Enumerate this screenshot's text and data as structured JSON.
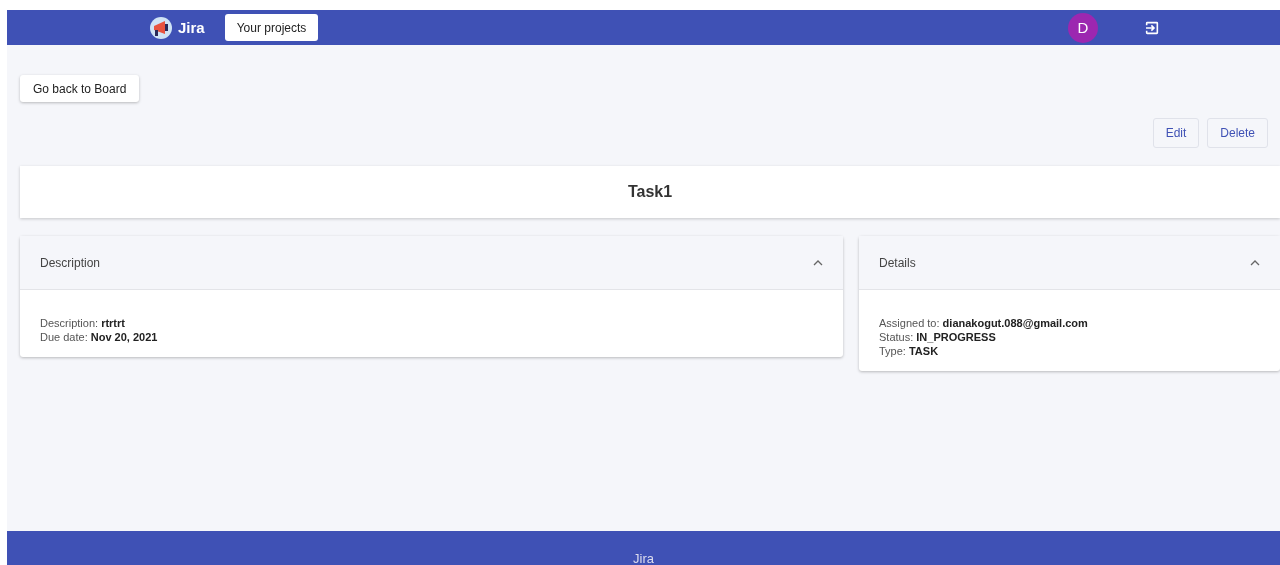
{
  "header": {
    "brand": "Jira",
    "nav_button": "Your projects",
    "avatar": "D"
  },
  "back_button": "Go back to Board",
  "actions": [
    "Edit",
    "Delete"
  ],
  "task_title": "Task1",
  "panels": [
    {
      "title": "Description",
      "expanded": true,
      "fields": [
        {
          "label": "Description:",
          "value": "rtrtrt"
        },
        {
          "label": "Due date:",
          "value": "Nov 20, 2021"
        }
      ]
    },
    {
      "title": "Details",
      "expanded": true,
      "fields": [
        {
          "label": "Assigned to:",
          "value": "dianakogut.088@gmail.com"
        },
        {
          "label": "Status:",
          "value": "IN_PROGRESS"
        },
        {
          "label": "Type:",
          "value": "TASK"
        }
      ]
    }
  ],
  "footer": "Jira"
}
